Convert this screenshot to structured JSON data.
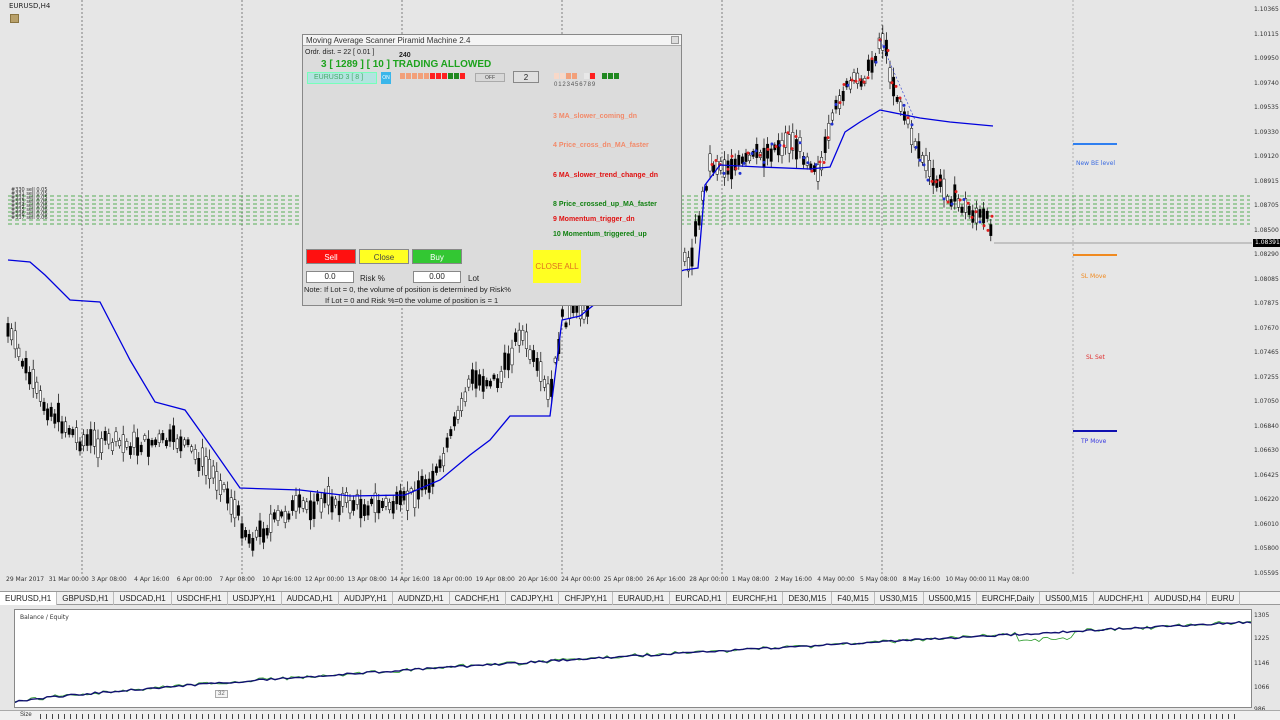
{
  "chart": {
    "title": "EURUSD,H4",
    "symbol_title": "EURUSD,H4",
    "current_price": "1.08391",
    "price_ticks": [
      "1.10365",
      "1.10115",
      "1.09950",
      "1.09740",
      "1.09535",
      "1.09330",
      "1.09120",
      "1.08915",
      "1.08705",
      "1.08500",
      "1.08290",
      "1.08085",
      "1.07875",
      "1.07670",
      "1.07465",
      "1.07255",
      "1.07050",
      "1.06840",
      "1.06630",
      "1.06425",
      "1.06220",
      "1.06010",
      "1.05800",
      "1.05595"
    ],
    "time_ticks": [
      "29 Mar 2017",
      "31 Mar 00:00",
      "3 Apr 08:00",
      "4 Apr 16:00",
      "6 Apr 00:00",
      "7 Apr 08:00",
      "10 Apr 16:00",
      "12 Apr 00:00",
      "13 Apr 08:00",
      "14 Apr 16:00",
      "18 Apr 00:00",
      "19 Apr 08:00",
      "20 Apr 16:00",
      "24 Apr 00:00",
      "25 Apr 08:00",
      "26 Apr 16:00",
      "28 Apr 00:00",
      "1 May 08:00",
      "2 May 16:00",
      "4 May 00:00",
      "5 May 08:00",
      "8 May 16:00",
      "10 May 00:00",
      "11 May 08:00"
    ],
    "grid_labels": [
      "#330 sell 0.05",
      "#331 sell 0.05",
      "#332 sell 0.05",
      "#333 sell 0.06",
      "#334 sell 0.06",
      "#335 sell 0.06",
      "#336 sell 0.06",
      "#337 sell 0.06"
    ],
    "side_labels": {
      "new_be": "New BE level",
      "sl_move": "SL Move",
      "sl_set": "SL Set",
      "tp_move": "TP Move"
    }
  },
  "panel": {
    "title": "Moving Average Scanner Piramid Machine 2.4",
    "order_dist": "Ordr. dist. = 22 [ 0.01 ]",
    "timeframe": "240",
    "status": "3 [ 1289 ] [ 10 ] TRADING ALLOWED",
    "symbol_box": "EURUSD 3 [ 8 ]",
    "on_label": "ON",
    "off_label": "OFF",
    "number_button": "2",
    "indicator_digits": "0 1 2 3 4 5 6 7 8 9",
    "signals": [
      {
        "text": "3 MA_slower_coming_dn",
        "color": "#f28a6a"
      },
      {
        "text": "4 Price_cross_dn_MA_faster",
        "color": "#f28a6a"
      },
      {
        "text": "6 MA_slower_trend_change_dn",
        "color": "#e01010"
      },
      {
        "text": "8 Price_crossed_up_MA_faster",
        "color": "#108010"
      },
      {
        "text": "9 Momentum_trigger_dn",
        "color": "#e01010"
      },
      {
        "text": "10 Momentum_triggered_up",
        "color": "#108010"
      }
    ],
    "sell_label": "Sell",
    "close_label": "Close",
    "buy_label": "Buy",
    "close_all_label": "CLOSE ALL",
    "risk_value": "0.0",
    "risk_label": "Risk %",
    "lot_value": "0.00",
    "lot_label": "Lot",
    "note_line1": "Note: If Lot = 0, the volume of position is determined by Risk%",
    "note_line2": "If Lot = 0 and Risk %=0 the volume of position is = 1"
  },
  "tabs": [
    "EURUSD,H1",
    "GBPUSD,H1",
    "USDCAD,H1",
    "USDCHF,H1",
    "USDJPY,H1",
    "AUDCAD,H1",
    "AUDJPY,H1",
    "AUDNZD,H1",
    "CADCHF,H1",
    "CADJPY,H1",
    "CHFJPY,H1",
    "EURAUD,H1",
    "EURCAD,H1",
    "EURCHF,H1",
    "DE30,M15",
    "F40,M15",
    "US30,M15",
    "US500,M15",
    "EURCHF,Daily",
    "US500,M15",
    "AUDCHF,H1",
    "AUDUSD,H4",
    "EURU"
  ],
  "equity": {
    "label": "Balance / Equity",
    "scale": [
      "1305",
      "1225",
      "1146",
      "1066",
      "986"
    ],
    "marker": "32"
  },
  "bottom": {
    "label": "Size"
  },
  "colors": {
    "ma_line": "#0000dd",
    "buy_green": "#33c733",
    "sell_red": "#ff1010",
    "close_yellow": "#ffff22",
    "status_green": "#1ea31e"
  }
}
